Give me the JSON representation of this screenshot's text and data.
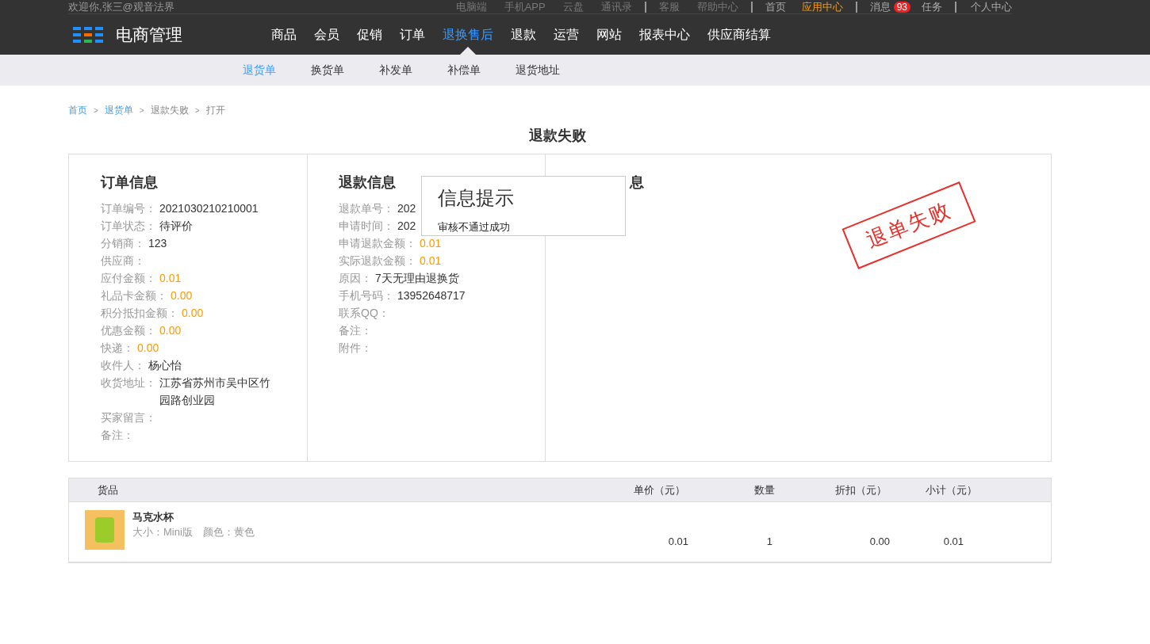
{
  "top_bar": {
    "welcome": "欢迎你,张三@观音法界",
    "links_group_1": [
      "电脑端",
      "手机APP",
      "云盘",
      "通讯录"
    ],
    "links_group_2": [
      "客服",
      "帮助中心"
    ],
    "links_group_3": [
      {
        "label": "首页",
        "selected": false
      },
      {
        "label": "应用中心",
        "selected": true
      }
    ],
    "messages": {
      "label": "消息",
      "count": "93"
    },
    "tasks": "任务",
    "profile": "个人中心"
  },
  "app_title": "电商管理",
  "main_nav": [
    {
      "label": "商品",
      "selected": false
    },
    {
      "label": "会员",
      "selected": false
    },
    {
      "label": "促销",
      "selected": false
    },
    {
      "label": "订单",
      "selected": false
    },
    {
      "label": "退换售后",
      "selected": true
    },
    {
      "label": "退款",
      "selected": false
    },
    {
      "label": "运营",
      "selected": false
    },
    {
      "label": "网站",
      "selected": false
    },
    {
      "label": "报表中心",
      "selected": false
    },
    {
      "label": "供应商结算",
      "selected": false
    }
  ],
  "sub_nav": [
    {
      "label": "退货单",
      "selected": true
    },
    {
      "label": "换货单",
      "selected": false
    },
    {
      "label": "补发单",
      "selected": false
    },
    {
      "label": "补偿单",
      "selected": false
    },
    {
      "label": "退货地址",
      "selected": false
    }
  ],
  "breadcrumb_separator": ">",
  "breadcrumb": [
    {
      "label": "首页",
      "kind": "link"
    },
    {
      "label": "退货单",
      "kind": "link"
    },
    {
      "label": "退款失败",
      "kind": "text"
    },
    {
      "label": "打开",
      "kind": "text"
    }
  ],
  "page_title": "退款失败",
  "order_info": {
    "title": "订单信息",
    "rows": [
      {
        "label": "订单编号：",
        "value": "2021030210210001",
        "kind": "text"
      },
      {
        "label": "订单状态：",
        "value": "待评价",
        "kind": "text"
      },
      {
        "label": "分销商：",
        "value": "123",
        "kind": "text"
      },
      {
        "label": "供应商：",
        "kind": "text"
      },
      {
        "label": "应付金额：",
        "value": "0.01",
        "kind": "money"
      },
      {
        "label": "礼品卡金额：",
        "value": "0.00",
        "kind": "money"
      },
      {
        "label": "积分抵扣金额：",
        "value": "0.00",
        "kind": "money"
      },
      {
        "label": "优惠金额：",
        "value": "0.00",
        "kind": "money"
      },
      {
        "label": "快递：",
        "value": "0.00",
        "kind": "money"
      },
      {
        "label": "收件人：",
        "value": "杨心怡",
        "kind": "text"
      },
      {
        "label": "收货地址：",
        "value": "江苏省苏州市吴中区竹园路创业园",
        "kind": "text"
      },
      {
        "label": "买家留言：",
        "kind": "text"
      },
      {
        "label": "备注：",
        "kind": "text"
      }
    ]
  },
  "refund_info": {
    "title": "退款信息",
    "rows": [
      {
        "label": "退款单号：",
        "value": "202",
        "kind": "text"
      },
      {
        "label": "申请时间：",
        "value": "202",
        "kind": "text"
      },
      {
        "label": "申请退款金额：",
        "value": "0.01",
        "kind": "money"
      },
      {
        "label": "实际退款金额：",
        "value": "0.01",
        "kind": "money"
      },
      {
        "label": "原因：",
        "value": "7天无理由退换货",
        "kind": "text"
      },
      {
        "label": "手机号码：",
        "value": "13952648717",
        "kind": "text"
      },
      {
        "label": "联系QQ：",
        "kind": "text"
      },
      {
        "label": "备注：",
        "kind": "text"
      },
      {
        "label": "附件：",
        "kind": "text"
      }
    ]
  },
  "third_panel": {
    "title": "息"
  },
  "stamp": "退单失败",
  "popup": {
    "title": "信息提示",
    "message": "审核不通过成功"
  },
  "goods_table": {
    "columns": [
      "货品",
      "单价（元）",
      "数量",
      "折扣（元）",
      "小计（元）"
    ],
    "rows": [
      {
        "name": "马克水杯",
        "spec": "大小：Mini版　颜色：黄色",
        "price": "0.01",
        "quantity": "1",
        "discount": "0.00",
        "subtotal": "0.01"
      }
    ]
  }
}
